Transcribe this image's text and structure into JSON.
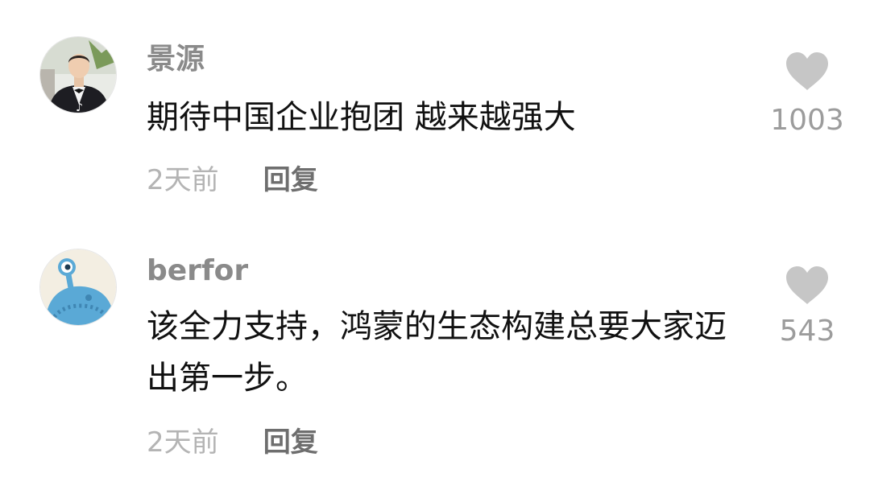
{
  "comments": [
    {
      "username": "景源",
      "content": "期待中国企业抱团 越来越强大",
      "time": "2天前",
      "reply_label": "回复",
      "like_count": "1003",
      "avatar": "man-in-tuxedo-photo"
    },
    {
      "username": "berfor",
      "content": "该全力支持，鸿蒙的生态构建总要大家迈出第一步。",
      "time": "2天前",
      "reply_label": "回复",
      "like_count": "543",
      "avatar": "blue-cartoon-creature"
    }
  ],
  "colors": {
    "username": "#8a8a8a",
    "content": "#111111",
    "time": "#b4b4b4",
    "reply": "#6e6e6e",
    "heart": "#c6c6c6",
    "like_count": "#9c9c9c"
  },
  "icons": {
    "like": "heart-icon"
  }
}
